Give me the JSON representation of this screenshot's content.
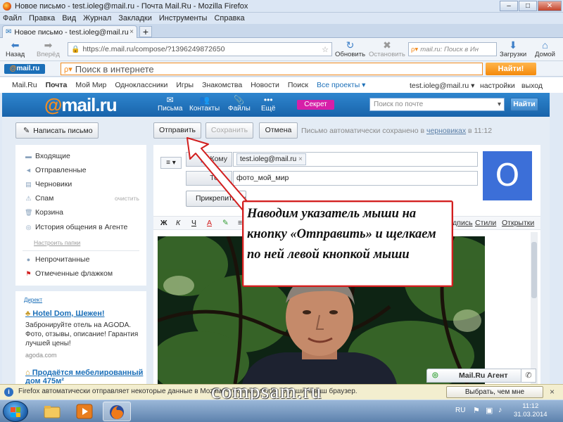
{
  "window": {
    "title": "Новое письмо - test.ioleg@mail.ru - Почта Mail.Ru - Mozilla Firefox",
    "btn_min": "–",
    "btn_max": "□",
    "btn_close": "✕"
  },
  "menubar": [
    "Файл",
    "Правка",
    "Вид",
    "Журнал",
    "Закладки",
    "Инструменты",
    "Справка"
  ],
  "tab": {
    "label": "Новое письмо - test.ioleg@mail.ru - По...",
    "close": "×",
    "new": "+"
  },
  "nav": {
    "back": "Назад",
    "forward": "Вперёд",
    "url": "https://e.mail.ru/compose/?1396249872650",
    "refresh": "Обновить",
    "stop": "Остановить",
    "search_placeholder": "mail.ru: Поиск в Ин",
    "downloads": "Загрузки",
    "home": "Домой"
  },
  "mr_toolbar": {
    "logo_prefix": "@",
    "logo_text": "mail.ru",
    "search_placeholder": "Поиск в интернете",
    "find": "Найти!"
  },
  "topnav": {
    "items": [
      "Mail.Ru",
      "Почта",
      "Мой Мир",
      "Одноклассники",
      "Игры",
      "Знакомства",
      "Новости",
      "Поиск",
      "Все проекты ▾"
    ],
    "account": "test.ioleg@mail.ru ▾",
    "settings": "настройки",
    "logout": "выход"
  },
  "header": {
    "logo_at": "@",
    "logo_text": "mail.ru",
    "tabs": [
      {
        "icon": "✉",
        "label": "Письма"
      },
      {
        "icon": "👥",
        "label": "Контакты"
      },
      {
        "icon": "📎",
        "label": "Файлы"
      },
      {
        "icon": "•••",
        "label": "Ещё"
      }
    ],
    "secret": "Секрет",
    "search_placeholder": "Поиск по почте",
    "find": "Найти"
  },
  "sidebar": {
    "write": "Написать письмо",
    "folders": [
      {
        "icon": "▬",
        "label": "Входящие"
      },
      {
        "icon": "◄",
        "label": "Отправленные"
      },
      {
        "icon": "▤",
        "label": "Черновики"
      },
      {
        "icon": "⚠",
        "label": "Спам",
        "action": "очистить"
      },
      {
        "icon": "🗑",
        "label": "Корзина"
      },
      {
        "icon": "◎",
        "label": "История общения в Агенте"
      }
    ],
    "setup": "Настроить папки",
    "filters": [
      {
        "icon": "●",
        "label": "Непрочитанные",
        "color": "#8aa3bd"
      },
      {
        "icon": "⚑",
        "label": "Отмеченные флажком",
        "color": "#d21f1f"
      }
    ]
  },
  "ad": {
    "label": "Директ",
    "title": "Hotel Dom, Шежен!",
    "text": "Забронируйте отель на AGODA. Фото, отзывы, описание! Гарантия лучшей цены!",
    "domain": "agoda.com",
    "title2": "Продаётся мебелированный дом 475м²"
  },
  "toolbar": {
    "send": "Отправить",
    "save": "Сохранить",
    "cancel": "Отмена",
    "autosave_prefix": "Письмо автоматически сохранено в ",
    "autosave_link": "черновиках",
    "autosave_time": " в 11:12"
  },
  "compose": {
    "format": "≡ ▾",
    "to_label": "Кому",
    "to_value": "test.ioleg@mail.ru",
    "to_remove": "×",
    "subject_label": "Тема",
    "subject_value": "фото_мой_мир",
    "attach": "Прикрепить файл",
    "avatar_letter": "О",
    "rte": [
      "Ж",
      "К",
      "Ч",
      "A",
      "✎",
      "≡"
    ],
    "signature": "Подпись",
    "styles": "Стили",
    "postcards": "Открытки"
  },
  "callout": {
    "text": "Наводим указатель мыши на кнопку «Отправить» и щелкаем по ней левой кнопкой мыши",
    "border_color": "#d21f1f"
  },
  "agent": {
    "label": "Mail.Ru Агент",
    "phone": "✆"
  },
  "notification": {
    "text": "Firefox автоматически отправляет некоторые данные в Mozilla, чтобы мы могли улучшить ваш браузер.",
    "button": "Выбрать, чем мне поделиться",
    "close": "×"
  },
  "watermark": "compsam.ru",
  "taskbar": {
    "apps": [
      "folder-icon",
      "media-icon",
      "firefox-icon"
    ],
    "lang": "RU",
    "time": "11:12",
    "date": "31.03.2014"
  }
}
